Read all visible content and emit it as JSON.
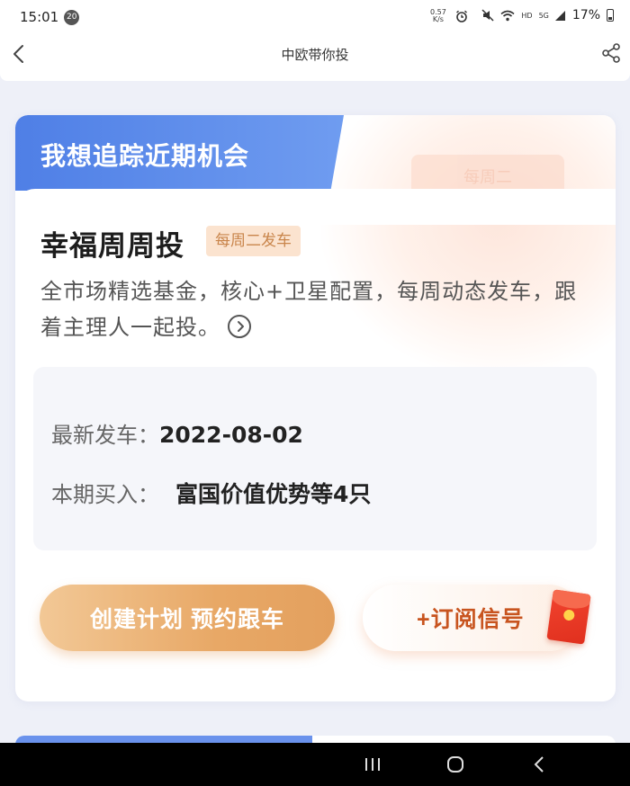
{
  "status_bar": {
    "time": "15:01",
    "notification_count": "20",
    "speed_value": "0.57",
    "speed_unit": "K/s",
    "network_hd": "HD",
    "network_5g": "5G",
    "battery": "17%"
  },
  "nav": {
    "title": "中欧带你投"
  },
  "card": {
    "header": "我想追踪近期机会",
    "deco_text": "每周二",
    "product_title": "幸福周周投",
    "product_tag": "每周二发车",
    "description": "全市场精选基金，核心+卫星配置，每周动态发车，跟着主理人一起投。",
    "info": {
      "latest_label": "最新发车：",
      "latest_value": "2022-08-02",
      "buy_label": "本期买入：",
      "buy_value": "富国价值优势等4只"
    },
    "create_button": "创建计划 预约跟车",
    "subscribe_button": "+订阅信号"
  },
  "colors": {
    "header_blue": "#4f7fe6",
    "tag_bg": "#fbe3cf",
    "tag_text": "#c9854b",
    "create_button": "#e8a866",
    "subscribe_text": "#c8541f",
    "envelope_red": "#e0301e"
  },
  "icons": {
    "back": "chevron-left-icon",
    "share": "share-icon",
    "arrow": "chevron-right-circle-icon",
    "sys_recent": "recent-apps-icon",
    "sys_home": "home-icon",
    "sys_back": "back-icon"
  }
}
